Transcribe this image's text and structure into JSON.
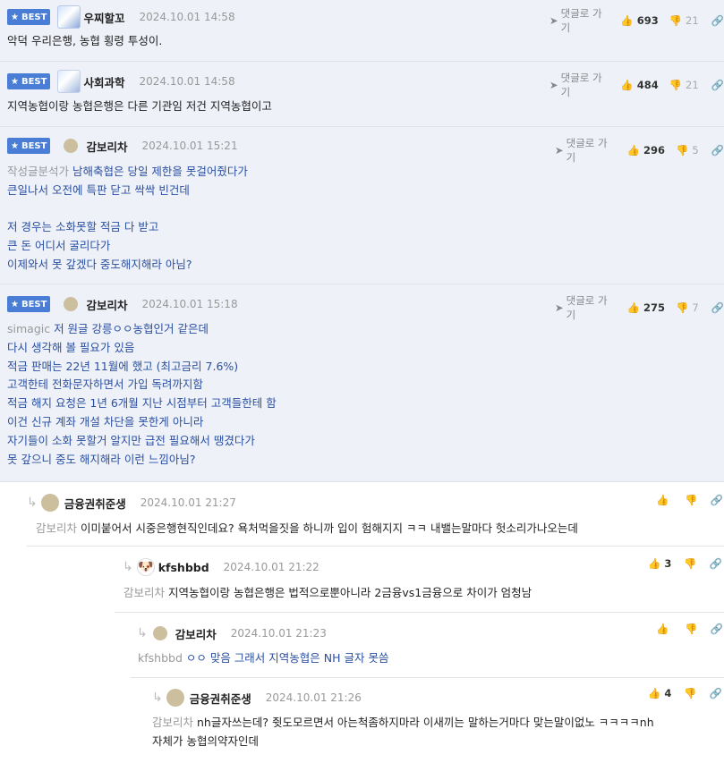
{
  "labels": {
    "best": "BEST",
    "goto": "댓글로 가기"
  },
  "best_comments": [
    {
      "nick": "우찌할꼬",
      "date": "2024.10.01 14:58",
      "up": "693",
      "down": "21",
      "lines": [
        "악덕 우리은행, 농협 횡령 투성이."
      ]
    },
    {
      "nick": "사회과학",
      "date": "2024.10.01 14:58",
      "up": "484",
      "down": "21",
      "lines": [
        "지역농협이랑 농협은행은 다른 기관임 저건 지역농협이고"
      ]
    },
    {
      "nick": "감보리차",
      "date": "2024.10.01 15:21",
      "up": "296",
      "down": "5",
      "mention": "작성글분석가",
      "lines": [
        " 남해축협은 당일 제한을 못걸어줬다가",
        "큰일나서 오전에 특판 닫고 싹싹 빈건데",
        "",
        "저 경우는 소화못할 적금 다 받고",
        "큰 돈 어디서 굴리다가",
        "이제와서 못 갚겠다 중도해지해라 아님?"
      ]
    },
    {
      "nick": "감보리차",
      "date": "2024.10.01 15:18",
      "up": "275",
      "down": "7",
      "mention": "simagic",
      "lines": [
        " 저 원글 강릉ㅇㅇ농협인거 같은데",
        "다시 생각해 볼 필요가 있음",
        "적금 판매는 22년 11월에 했고 (최고금리 7.6%)",
        "고객한테 전화문자하면서 가입 독려까지함",
        "적금 해지 요청은 1년 6개월 지난 시점부터 고객들한테 함",
        "이건 신규 계좌 개설 차단을 못한게 아니라",
        "자기들이 소화 못할거 알지만 급전 필요해서 땡겼다가",
        "못 갚으니 중도 해지해라 이런 느낌아님?"
      ]
    }
  ],
  "replies": [
    {
      "nick": "금융권취준생",
      "date": "2024.10.01 21:27",
      "up": "",
      "mention": "감보리차",
      "lines": [
        " 이미붙어서 시중은행현직인데요? 욕처먹을짓을 하니까 입이 험해지지 ㅋㅋ 내밸는말마다 헛소리가나오는데"
      ]
    },
    {
      "nick": "kfshbbd",
      "date": "2024.10.01 21:22",
      "up": "3",
      "mention": "감보리차",
      "lines": [
        " 지역농협이랑 농협은행은 법적으로뿐아니라 2금융vs1금융으로 차이가 엄청남"
      ]
    },
    {
      "nick": "감보리차",
      "date": "2024.10.01 21:23",
      "up": "",
      "mention": "kfshbbd",
      "lines": [
        " ㅇㅇ 맞음 그래서 지역농협은 NH 글자 못씀"
      ]
    },
    {
      "nick": "금융권취준생",
      "date": "2024.10.01 21:26",
      "up": "4",
      "mention": "감보리차",
      "lines": [
        " nh글자쓰는데? 쥣도모르면서 아는척좀하지마라 이새끼는 말하는거마다 맞는말이없노 ㅋㅋㅋㅋnh",
        "자체가 농협의약자인데"
      ]
    }
  ]
}
